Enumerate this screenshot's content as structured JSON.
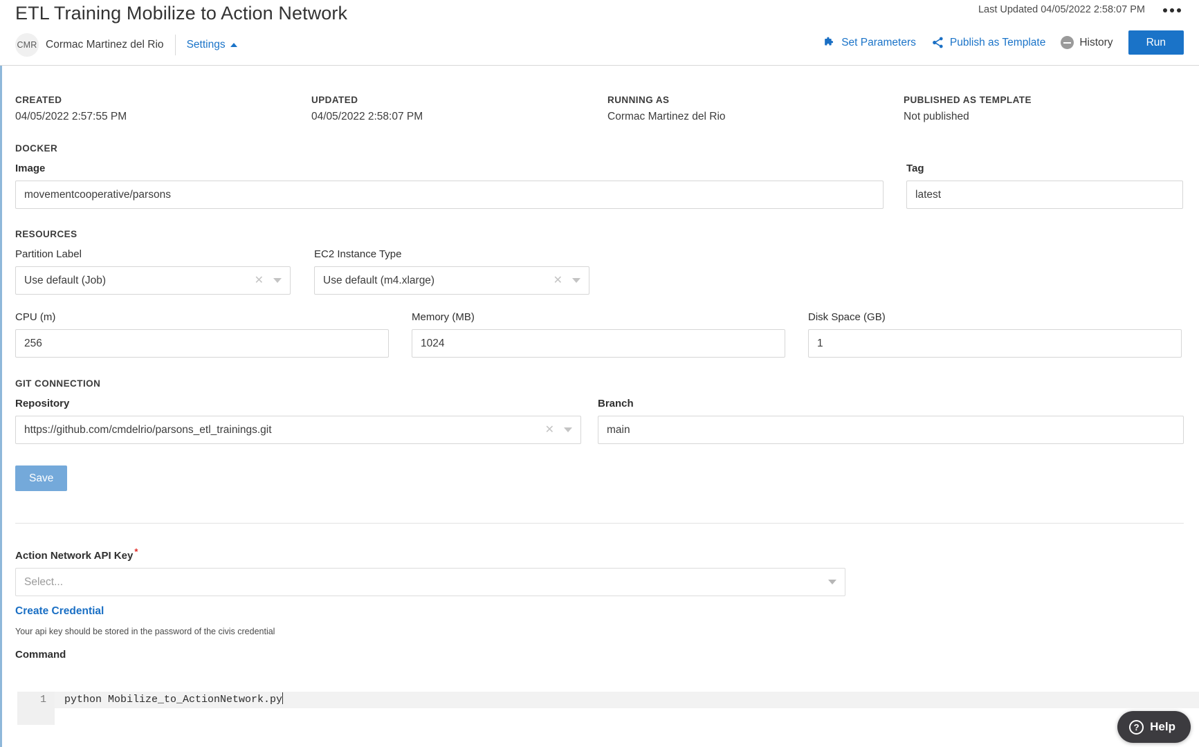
{
  "header": {
    "title": "ETL Training Mobilize to Action Network",
    "last_updated": "Last Updated 04/05/2022 2:58:07 PM",
    "avatar_initials": "CMR",
    "owner": "Cormac Martinez del Rio",
    "settings_label": "Settings",
    "actions": {
      "set_parameters": "Set Parameters",
      "publish_as_template": "Publish as Template",
      "history": "History",
      "run": "Run"
    }
  },
  "meta": {
    "created_label": "CREATED",
    "created_value": "04/05/2022 2:57:55 PM",
    "updated_label": "UPDATED",
    "updated_value": "04/05/2022 2:58:07 PM",
    "running_as_label": "RUNNING AS",
    "running_as_value": "Cormac Martinez del Rio",
    "published_label": "PUBLISHED AS TEMPLATE",
    "published_value": "Not published"
  },
  "docker": {
    "section": "DOCKER",
    "image_label": "Image",
    "image_value": "movementcooperative/parsons",
    "tag_label": "Tag",
    "tag_value": "latest"
  },
  "resources": {
    "section": "RESOURCES",
    "partition_label": "Partition Label",
    "partition_value": "Use default (Job)",
    "ec2_label": "EC2 Instance Type",
    "ec2_value": "Use default (m4.xlarge)",
    "cpu_label": "CPU (m)",
    "cpu_value": "256",
    "memory_label": "Memory (MB)",
    "memory_value": "1024",
    "disk_label": "Disk Space (GB)",
    "disk_value": "1"
  },
  "git": {
    "section": "GIT CONNECTION",
    "repository_label": "Repository",
    "repository_value": "https://github.com/cmdelrio/parsons_etl_trainings.git",
    "branch_label": "Branch",
    "branch_value": "main"
  },
  "save": {
    "label": "Save"
  },
  "credential": {
    "label": "Action Network API Key",
    "required_marker": "*",
    "select_placeholder": "Select...",
    "create_link": "Create Credential",
    "help_text": "Your api key should be stored in the password of the civis credential"
  },
  "command": {
    "label": "Command",
    "line_number": "1",
    "line_text": "python Mobilize_to_ActionNetwork.py"
  },
  "help_fab": {
    "label": "Help",
    "icon": "?"
  },
  "colors": {
    "accent_blue": "#1a73c8",
    "save_blue": "#74a9da",
    "required_red": "#e02b27",
    "help_dark": "#3c3b3f"
  }
}
